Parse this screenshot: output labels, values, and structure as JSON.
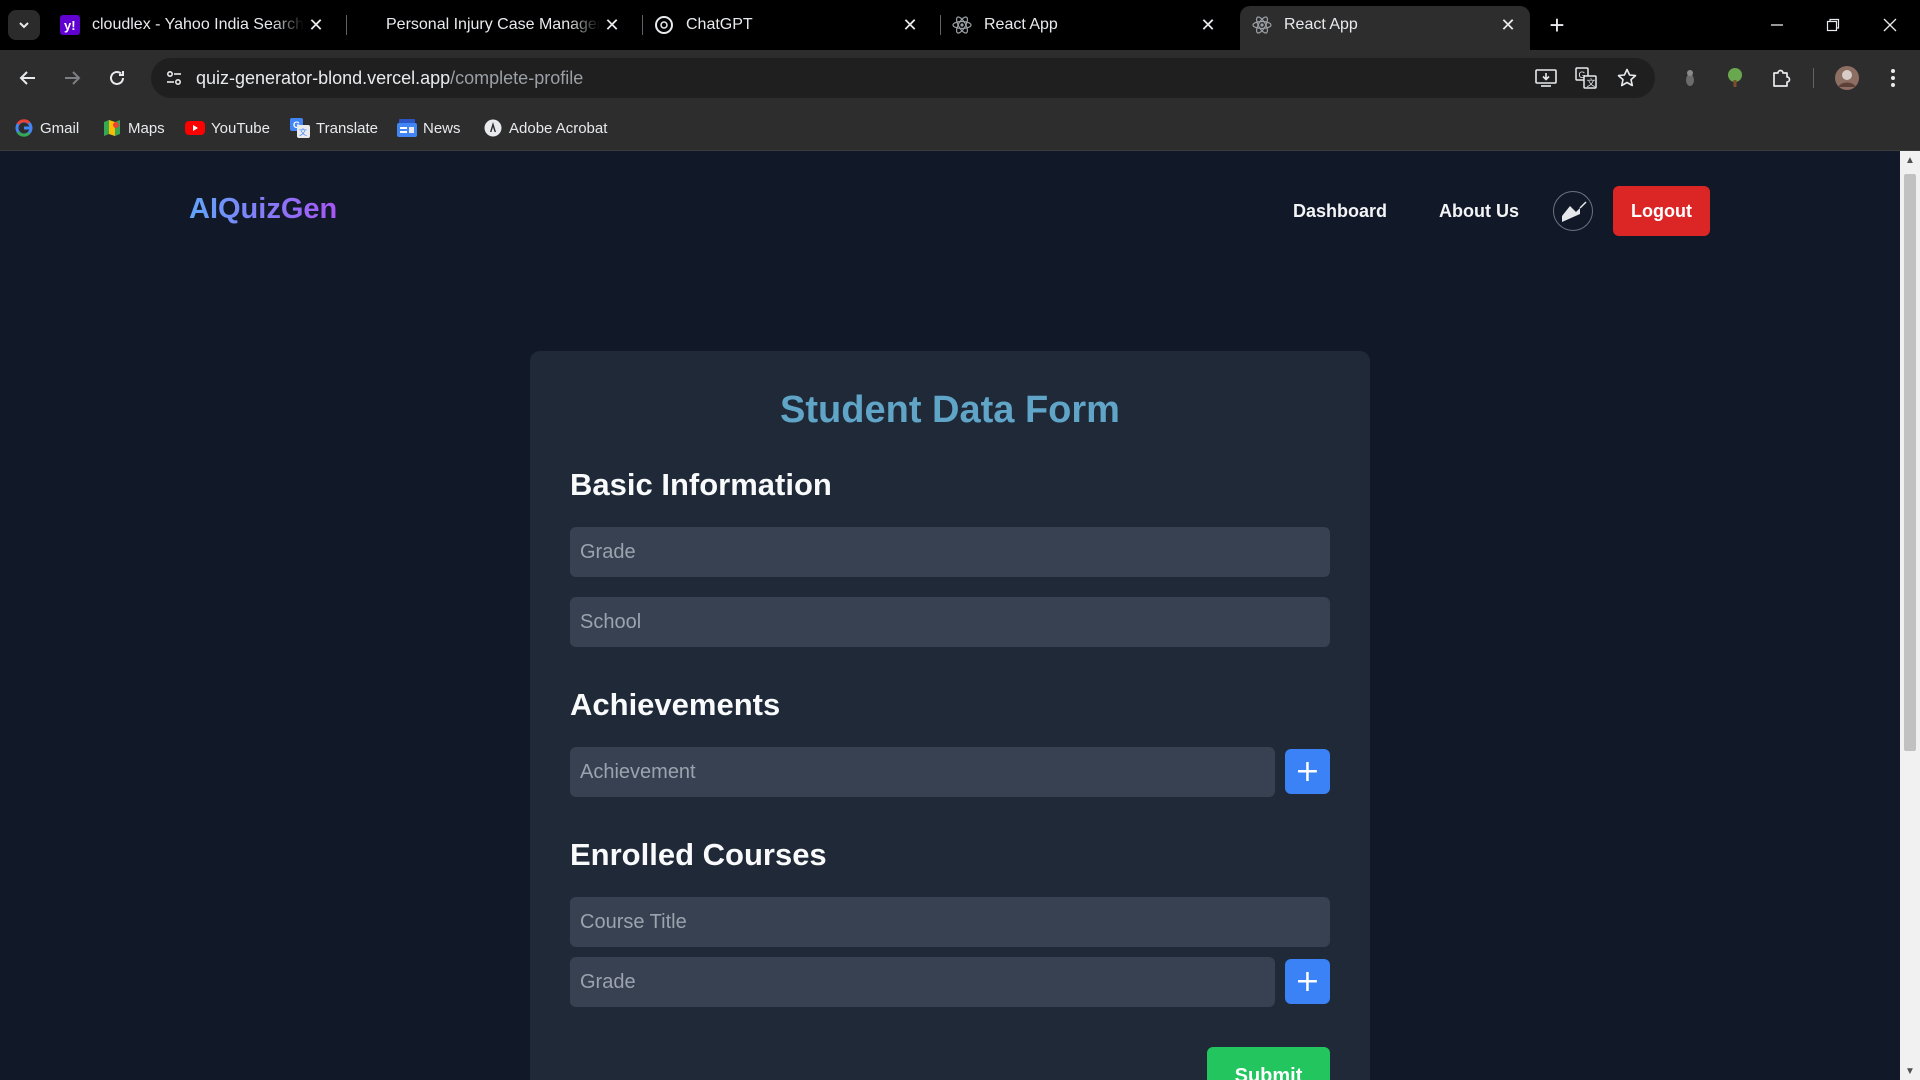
{
  "browser": {
    "tabs": [
      {
        "title": "cloudlex - Yahoo India Search R",
        "favicon": "yahoo-icon",
        "active": false
      },
      {
        "title": "Personal Injury Case Manageme",
        "favicon": "none",
        "active": false
      },
      {
        "title": "ChatGPT",
        "favicon": "chatgpt-icon",
        "active": false
      },
      {
        "title": "React App",
        "favicon": "react-icon",
        "active": false
      },
      {
        "title": "React App",
        "favicon": "react-icon",
        "active": true
      }
    ],
    "url_host": "quiz-generator-blond.vercel.app",
    "url_path": "/complete-profile",
    "bookmarks": [
      {
        "label": "Gmail",
        "icon": "google-icon"
      },
      {
        "label": "Maps",
        "icon": "maps-icon"
      },
      {
        "label": "YouTube",
        "icon": "youtube-icon"
      },
      {
        "label": "Translate",
        "icon": "translate-icon"
      },
      {
        "label": "News",
        "icon": "news-icon"
      },
      {
        "label": "Adobe Acrobat",
        "icon": "acrobat-icon"
      }
    ]
  },
  "navbar": {
    "logo": "AIQuizGen",
    "links": {
      "dashboard": "Dashboard",
      "about": "About Us"
    },
    "logout": "Logout"
  },
  "form": {
    "title": "Student Data Form",
    "basic": {
      "heading": "Basic Information",
      "grade_placeholder": "Grade",
      "school_placeholder": "School"
    },
    "achievements": {
      "heading": "Achievements",
      "achievement_placeholder": "Achievement",
      "add_label": "+"
    },
    "courses": {
      "heading": "Enrolled Courses",
      "course_title_placeholder": "Course Title",
      "grade_placeholder": "Grade",
      "add_label": "+"
    },
    "submit": "Submit"
  },
  "colors": {
    "page_bg": "#111827",
    "card_bg": "#1f2937",
    "input_bg": "#374151",
    "title_accent": "#60a5c8",
    "add_button": "#3b82f6",
    "logout_button": "#dc2626",
    "submit_button": "#22c55e"
  }
}
